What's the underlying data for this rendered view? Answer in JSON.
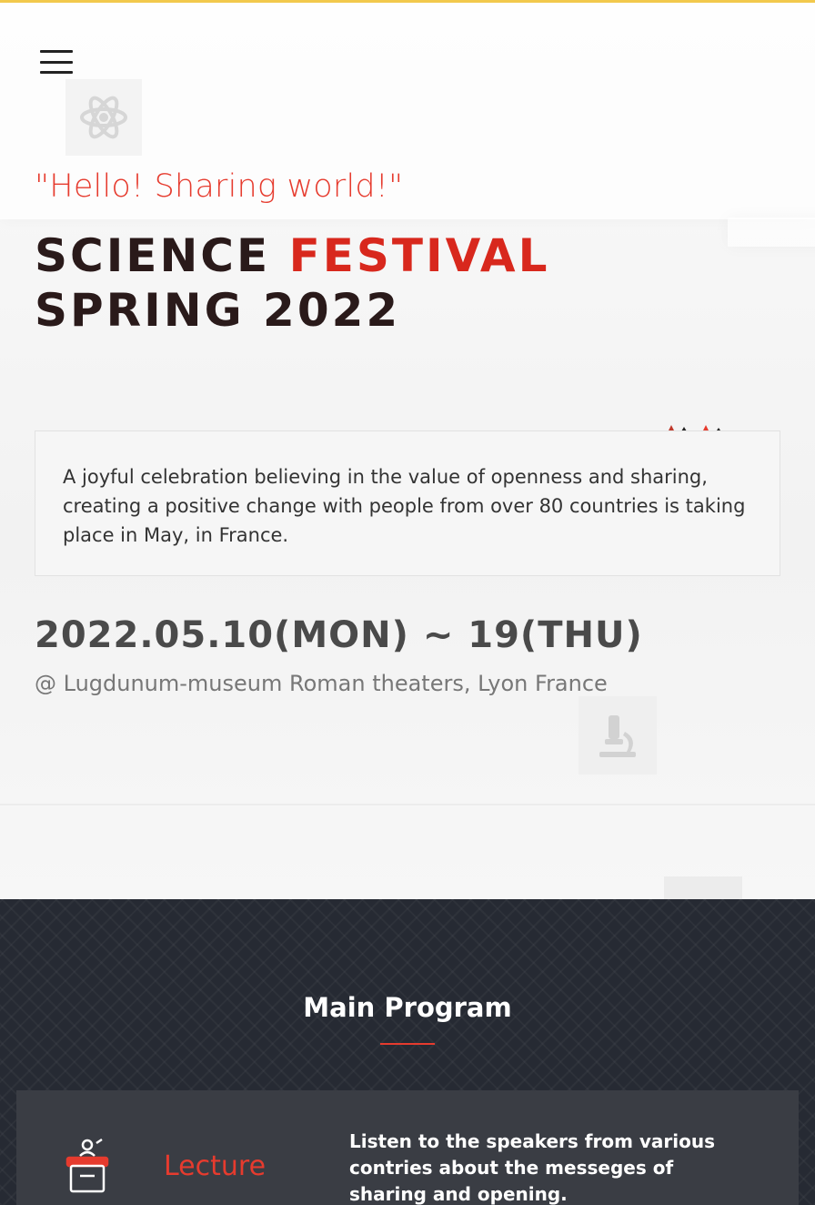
{
  "header": {
    "menu_icon": "hamburger-menu-icon"
  },
  "hero": {
    "atom_icon": "atom-icon",
    "slogan": "\"Hello! Sharing world!\"",
    "title_line1_part1": "SCIENCE",
    "title_line1_part2": "FESTIVAL",
    "title_line2": "SPRING 2022",
    "description": "A joyful celebration believing in the value of openness and sharing, creating a positive change with people from over 80 countries is taking place in May, in France.",
    "date": "2022.05.10(MON) ~ 19(THU)",
    "venue": "@ Lugdunum-museum Roman theaters, Lyon France",
    "microscope_icon": "microscope-icon"
  },
  "program": {
    "title": "Main Program",
    "items": [
      {
        "icon": "lecture-podium-icon",
        "label": "Lecture",
        "description": "Listen to the speakers from various contries about the messeges of sharing and opening."
      }
    ]
  },
  "colors": {
    "accent": "#e63b2e",
    "dark_section": "#262a33",
    "card": "#3a3d44",
    "top_strip": "#f2c94c"
  }
}
